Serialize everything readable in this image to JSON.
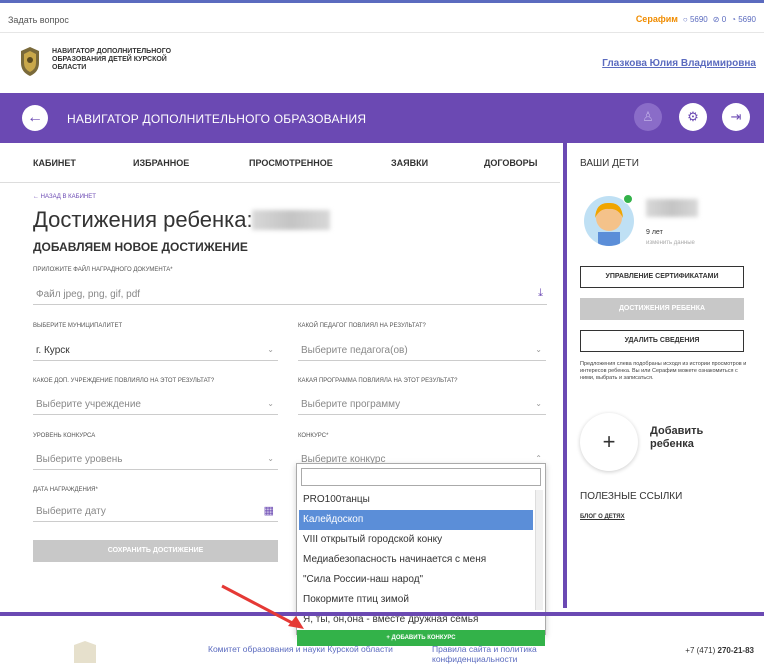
{
  "topbar": {
    "ask_label": "Задать вопрос",
    "serafim_label": "Серафим",
    "counter1": "5690",
    "counter2": "0",
    "counter3": "5690"
  },
  "header": {
    "org_name": "НАВИГАТОР ДОПОЛНИТЕЛЬНОГО ОБРАЗОВАНИЯ ДЕТЕЙ КУРСКОЙ ОБЛАСТИ",
    "user_name": "Глазкова Юлия Владимировна"
  },
  "navbar": {
    "back_icon": "arrow-left-icon",
    "title": "НАВИГАТОР ДОПОЛНИТЕЛЬНОГО ОБРАЗОВАНИЯ",
    "icons": [
      "user-icon",
      "filter-icon",
      "logout-icon"
    ]
  },
  "tabs": [
    {
      "label": "КАБИНЕТ"
    },
    {
      "label": "ИЗБРАННОЕ"
    },
    {
      "label": "ПРОСМОТРЕННОЕ"
    },
    {
      "label": "ЗАЯВКИ"
    },
    {
      "label": "ДОГОВОРЫ"
    }
  ],
  "sidebar": {
    "heading": "ВАШИ ДЕТИ",
    "child_age": "9 лет",
    "change_data_label": "изменить данные",
    "btn_certificates": "УПРАВЛЕНИЕ СЕРТИФИКАТАМИ",
    "btn_achievements": "ДОСТИЖЕНИЯ РЕБЕНКА",
    "btn_delete": "УДАЛИТЬ СВЕДЕНИЯ",
    "note": "Предложения слева подобраны исходя из истории просмотров и интересов ребенка. Вы или Серафим можете ознакомиться с ними, выбрать и записаться.",
    "add_child_label": "Добавить ребенка",
    "links_heading": "ПОЛЕЗНЫЕ ССЫЛКИ",
    "blog_link": "БЛОГ О ДЕТЯХ"
  },
  "main": {
    "back_link": "НАЗАД В КАБИНЕТ",
    "title": "Достижения ребенка:",
    "subtitle": "ДОБАВЛЯЕМ НОВОЕ ДОСТИЖЕНИЕ",
    "file_label": "ПРИЛОЖИТЕ ФАЙЛ НАГРАДНОГО ДОКУМЕНТА*",
    "file_placeholder": "Файл jpeg, png, gif, pdf",
    "municipality_label": "ВЫБЕРИТЕ МУНИЦИПАЛИТЕТ",
    "municipality_value": "г. Курск",
    "teacher_label": "КАКОЙ ПЕДАГОГ ПОВЛИЯЛ НА РЕЗУЛЬТАТ?",
    "teacher_placeholder": "Выберите педагога(ов)",
    "institution_label": "КАКОЕ ДОП. УЧРЕЖДЕНИЕ ПОВЛИЯЛО НА ЭТОТ РЕЗУЛЬТАТ?",
    "institution_placeholder": "Выберите учреждение",
    "program_label": "КАКАЯ ПРОГРАММА ПОВЛИЯЛА НА ЭТОТ РЕЗУЛЬТАТ?",
    "program_placeholder": "Выберите программу",
    "level_label": "УРОВЕНЬ КОНКУРСА",
    "level_placeholder": "Выберите уровень",
    "contest_label": "КОНКУРС*",
    "contest_placeholder": "Выберите конкурс",
    "date_label": "ДАТА НАГРАЖДЕНИЯ*",
    "date_placeholder": "Выберите дату",
    "save_button": "СОХРАНИТЬ ДОСТИЖЕНИЕ"
  },
  "dropdown": {
    "items": [
      {
        "label": "PRO100танцы",
        "selected": false
      },
      {
        "label": "Калейдоскоп",
        "selected": true
      },
      {
        "label": "VIII открытый городской конку",
        "selected": false
      },
      {
        "label": "Медиабезопасность начинается с меня",
        "selected": false
      },
      {
        "label": "\"Сила России-наш народ\"",
        "selected": false
      },
      {
        "label": "Покормите птиц зимой",
        "selected": false
      },
      {
        "label": "Я, ты, он,она - вместе дружная семья",
        "selected": false
      }
    ],
    "add_button": "+ ДОБАВИТЬ КОНКУРС"
  },
  "footer": {
    "committee": "Комитет образования и науки Курской области",
    "policy": "Правила сайта и политика конфиденциальности",
    "phone_prefix": "+7 (471) ",
    "phone_number": "270-21-83"
  },
  "colors": {
    "brand": "#6b49b3",
    "accent": "#5b6bbf",
    "orange": "#f08c00",
    "green": "#33b249",
    "selected": "#5b8ed8"
  }
}
